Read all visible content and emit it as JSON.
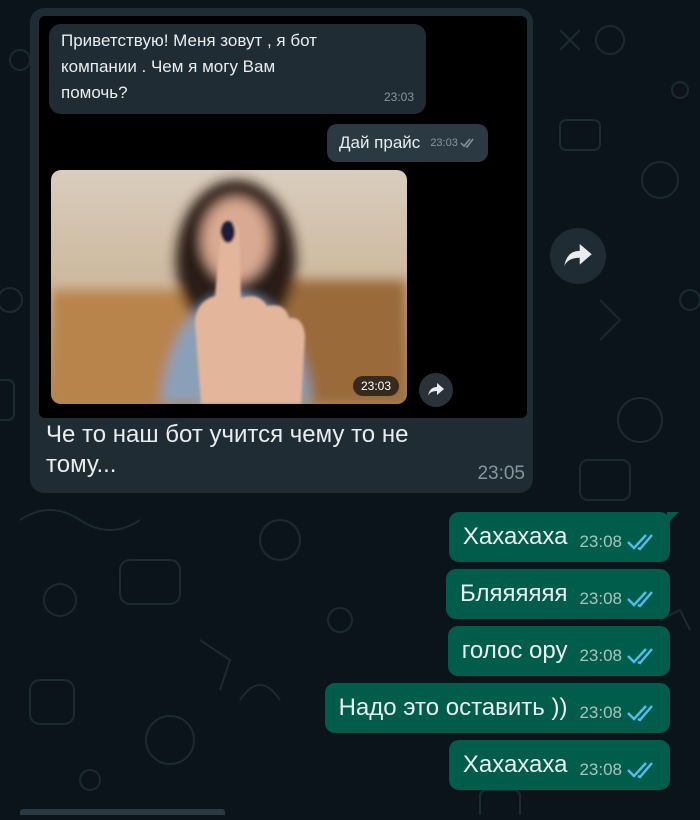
{
  "forwarded_screenshot": {
    "bot_message": {
      "text_line1": "Приветствую! Меня зовут , я бот",
      "text_line2": "компании               . Чем я могу Вам",
      "text_line3": "помочь?",
      "time": "23:03"
    },
    "user_message": {
      "text": "Дай прайс",
      "time": "23:03"
    },
    "photo": {
      "time": "23:03"
    }
  },
  "incoming": {
    "caption": "Че то наш бот учится чему то не тому...",
    "time": "23:05"
  },
  "outgoing": [
    {
      "text": "Хахахаха",
      "time": "23:08"
    },
    {
      "text": "Бляяяяяя",
      "time": "23:08"
    },
    {
      "text": "голос ору",
      "time": "23:08"
    },
    {
      "text": "Надо это оставить ))",
      "time": "23:08"
    },
    {
      "text": "Хахахаха",
      "time": "23:08"
    }
  ],
  "colors": {
    "background": "#0b141a",
    "incoming_bubble": "#1f2c34",
    "outgoing_bubble": "#005c4b",
    "read_check": "#53bdeb"
  },
  "icons": {
    "forward": "forward-icon",
    "read_receipt": "double-check-icon"
  }
}
